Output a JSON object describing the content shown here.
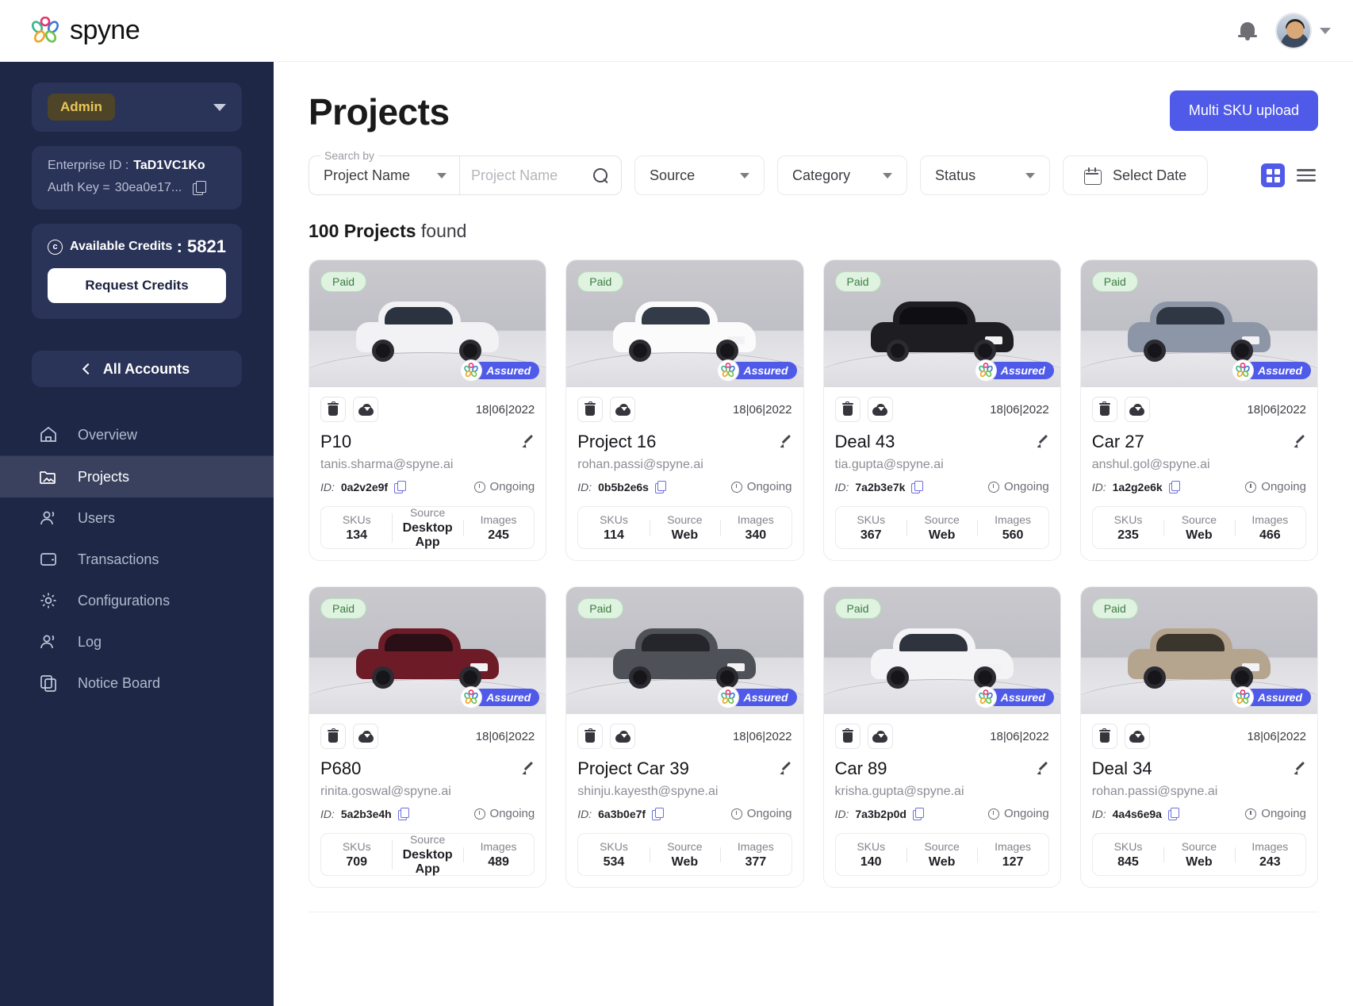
{
  "topbar": {
    "brand_name": "spyne",
    "bell_icon": "notification-bell-icon",
    "avatar_icon": "user-avatar",
    "chevron_icon": "chevron-down-icon"
  },
  "sidebar": {
    "role_chip": "Admin",
    "enterprise_label": "Enterprise ID :",
    "enterprise_id": "TaD1VC1Ko",
    "auth_label": "Auth Key =",
    "auth_key": "30ea0e17...",
    "credits_label": "Available Credits",
    "credits_separator": ": 5821",
    "credits_value": "5821",
    "request_credits_label": "Request Credits",
    "all_accounts_label": "All Accounts",
    "nav_items": [
      {
        "label": "Overview",
        "icon": "home-icon",
        "active": false
      },
      {
        "label": "Projects",
        "icon": "folder-image-icon",
        "active": true
      },
      {
        "label": "Users",
        "icon": "users-icon",
        "active": false
      },
      {
        "label": "Transactions",
        "icon": "wallet-icon",
        "active": false
      },
      {
        "label": "Configurations",
        "icon": "gear-icon",
        "active": false
      },
      {
        "label": "Log",
        "icon": "users-icon",
        "active": false
      },
      {
        "label": "Notice Board",
        "icon": "copy-board-icon",
        "active": false
      }
    ]
  },
  "main": {
    "page_title": "Projects",
    "multi_sku_label": "Multi SKU upload",
    "search": {
      "legend": "Search by",
      "select_value": "Project Name",
      "input_value": "",
      "placeholder": "Project Name",
      "search_icon": "search-icon"
    },
    "filters": [
      {
        "label": "Source",
        "icon": "chevron-down-icon"
      },
      {
        "label": "Category",
        "icon": "chevron-down-icon"
      },
      {
        "label": "Status",
        "icon": "chevron-down-icon"
      }
    ],
    "date_button": {
      "label": "Select Date",
      "icon": "calendar-icon"
    },
    "view_toggle": {
      "grid_icon": "grid-view-icon",
      "list_icon": "list-view-icon",
      "active": "grid"
    },
    "results_count": "100 Projects",
    "results_suffix": " found"
  },
  "cards": [
    {
      "badge": "Paid",
      "assured": "Assured",
      "date": "18|06|2022",
      "name": "P10",
      "email": "tanis.sharma@spyne.ai",
      "id_label": "ID:",
      "id": "0a2v2e9f",
      "status": "Ongoing",
      "skus_label": "SKUs",
      "skus": "134",
      "source_label": "Source",
      "source": "Desktop App",
      "images_label": "Images",
      "images": "245",
      "car_color": "#f2f2f4",
      "car_glass": "#2b3240"
    },
    {
      "badge": "Paid",
      "assured": "Assured",
      "date": "18|06|2022",
      "name": "Project 16",
      "email": "rohan.passi@spyne.ai",
      "id_label": "ID:",
      "id": "0b5b2e6s",
      "status": "Ongoing",
      "skus_label": "SKUs",
      "skus": "114",
      "source_label": "Source",
      "source": "Web",
      "images_label": "Images",
      "images": "340",
      "car_color": "#fbfbfc",
      "car_glass": "#333a48"
    },
    {
      "badge": "Paid",
      "assured": "Assured",
      "date": "18|06|2022",
      "name": "Deal 43",
      "email": "tia.gupta@spyne.ai",
      "id_label": "ID:",
      "id": "7a2b3e7k",
      "status": "Ongoing",
      "skus_label": "SKUs",
      "skus": "367",
      "source_label": "Source",
      "source": "Web",
      "images_label": "Images",
      "images": "560",
      "car_color": "#1d1d22",
      "car_glass": "#0f0f13"
    },
    {
      "badge": "Paid",
      "assured": "Assured",
      "date": "18|06|2022",
      "name": "Car 27",
      "email": "anshul.gol@spyne.ai",
      "id_label": "ID:",
      "id": "1a2g2e6k",
      "status": "Ongoing",
      "skus_label": "SKUs",
      "skus": "235",
      "source_label": "Source",
      "source": "Web",
      "images_label": "Images",
      "images": "466",
      "car_color": "#8d96a6",
      "car_glass": "#303744"
    },
    {
      "badge": "Paid",
      "assured": "Assured",
      "date": "18|06|2022",
      "name": "P680",
      "email": "rinita.goswal@spyne.ai",
      "id_label": "ID:",
      "id": "5a2b3e4h",
      "status": "Ongoing",
      "skus_label": "SKUs",
      "skus": "709",
      "source_label": "Source",
      "source": "Desktop App",
      "images_label": "Images",
      "images": "489",
      "car_color": "#6e1b28",
      "car_glass": "#2a1016"
    },
    {
      "badge": "Paid",
      "assured": "Assured",
      "date": "18|06|2022",
      "name": "Project Car 39",
      "email": "shinju.kayesth@spyne.ai",
      "id_label": "ID:",
      "id": "6a3b0e7f",
      "status": "Ongoing",
      "skus_label": "SKUs",
      "skus": "534",
      "source_label": "Source",
      "source": "Web",
      "images_label": "Images",
      "images": "377",
      "car_color": "#4e5157",
      "car_glass": "#24262b"
    },
    {
      "badge": "Paid",
      "assured": "Assured",
      "date": "18|06|2022",
      "name": "Car 89",
      "email": "krisha.gupta@spyne.ai",
      "id_label": "ID:",
      "id": "7a3b2p0d",
      "status": "Ongoing",
      "skus_label": "SKUs",
      "skus": "140",
      "source_label": "Source",
      "source": "Web",
      "images_label": "Images",
      "images": "127",
      "car_color": "#f4f4f6",
      "car_glass": "#2e333d"
    },
    {
      "badge": "Paid",
      "assured": "Assured",
      "date": "18|06|2022",
      "name": "Deal 34",
      "email": "rohan.passi@spyne.ai",
      "id_label": "ID:",
      "id": "4a4s6e9a",
      "status": "Ongoing",
      "skus_label": "SKUs",
      "skus": "845",
      "source_label": "Source",
      "source": "Web",
      "images_label": "Images",
      "images": "243",
      "car_color": "#b5a48e",
      "car_glass": "#3a352d"
    }
  ],
  "colors": {
    "accent": "#4f5ae8",
    "sidebar_bg": "#1e2746",
    "sidebar_card": "#2a3358",
    "role_chip_bg": "#4e4528",
    "role_chip_text": "#e8c65a",
    "paid_bg": "#dff3e0",
    "paid_text": "#3c7c45"
  }
}
